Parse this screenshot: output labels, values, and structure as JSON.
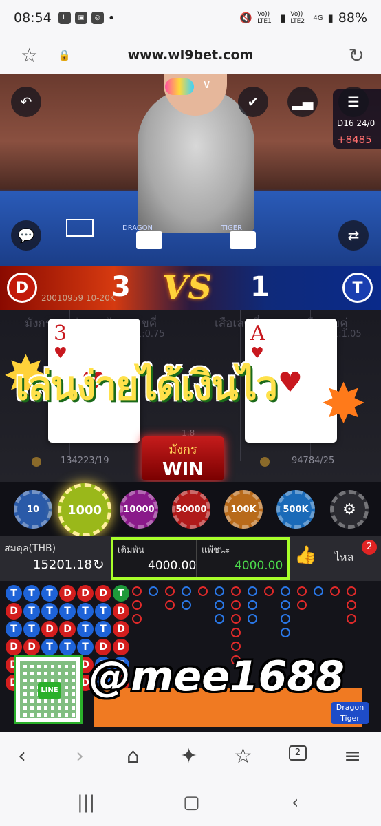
{
  "status_bar": {
    "time": "08:54",
    "sim1": "Vo)) LTE1",
    "sim2": "Vo)) LTE2",
    "network": "4G",
    "battery": "88%"
  },
  "browser": {
    "url": "www.wl9bet.com",
    "tab_count": "2"
  },
  "game": {
    "round_info": {
      "road": "D16 24/0",
      "delta": "+8485"
    },
    "felt_labels": {
      "dragon": "DRAGON",
      "tiger": "TIGER"
    },
    "vs": {
      "dragon_label": "D",
      "tiger_label": "T",
      "dragon_score": "3",
      "tiger_score": "1",
      "vs_text": "VS",
      "round_code": "20010959 10-20K"
    },
    "bet_area": {
      "dragon_even": "มังกรเลขคู่",
      "dragon_odd": "มังกรเลขคี่",
      "tiger_odd": "เสือเลขคี่",
      "tiger_even": "เสือเลขคู่",
      "payout_left": "1:0.75",
      "payout_right": "1:1.05",
      "center_payout": "1:8",
      "dragon_stat": "134223/19",
      "tiger_stat": "94784/25"
    },
    "cards": {
      "dragon": {
        "rank": "3",
        "suit": "♥"
      },
      "tiger": {
        "rank": "A",
        "suit": "♥"
      }
    },
    "promo_text": "เล่นง่ายได้เงินไว",
    "win": {
      "side": "มังกร",
      "label": "WIN"
    },
    "chips": [
      "10",
      "1000",
      "10000",
      "50000",
      "100K",
      "500K"
    ],
    "balance": {
      "label": "สมดุล(THB)",
      "value": "15201.18"
    },
    "bet": {
      "stake_label": "เดิมพัน",
      "stake_value": "4000.00",
      "win_label": "แพ้ชนะ",
      "win_value": "4000.00"
    },
    "tab": {
      "label": "ไหล",
      "badge": "2"
    },
    "bead_road": [
      [
        "T",
        "T",
        "T",
        "D",
        "D",
        "D",
        "T"
      ],
      [
        "D",
        "T",
        "T",
        "T",
        "T",
        "T",
        "D"
      ],
      [
        "T",
        "T",
        "D",
        "D",
        "T",
        "T",
        "D"
      ],
      [
        "D",
        "D",
        "T",
        "T",
        "T",
        "D",
        "D"
      ],
      [
        "D",
        "D",
        "D",
        "T",
        "D",
        "T",
        "T"
      ],
      [
        "D",
        "T",
        "T",
        "D",
        "D",
        "T",
        "D"
      ]
    ],
    "dragon_tiger_button": "Dragon Tiger"
  },
  "overlay": {
    "qr_label": "LINE",
    "handle": "@mee1688"
  },
  "colors": {
    "highlight": "#a8ff2a",
    "dragon": "#d41e1e",
    "tiger": "#1e63d8",
    "win_green": "#4bd84b"
  }
}
